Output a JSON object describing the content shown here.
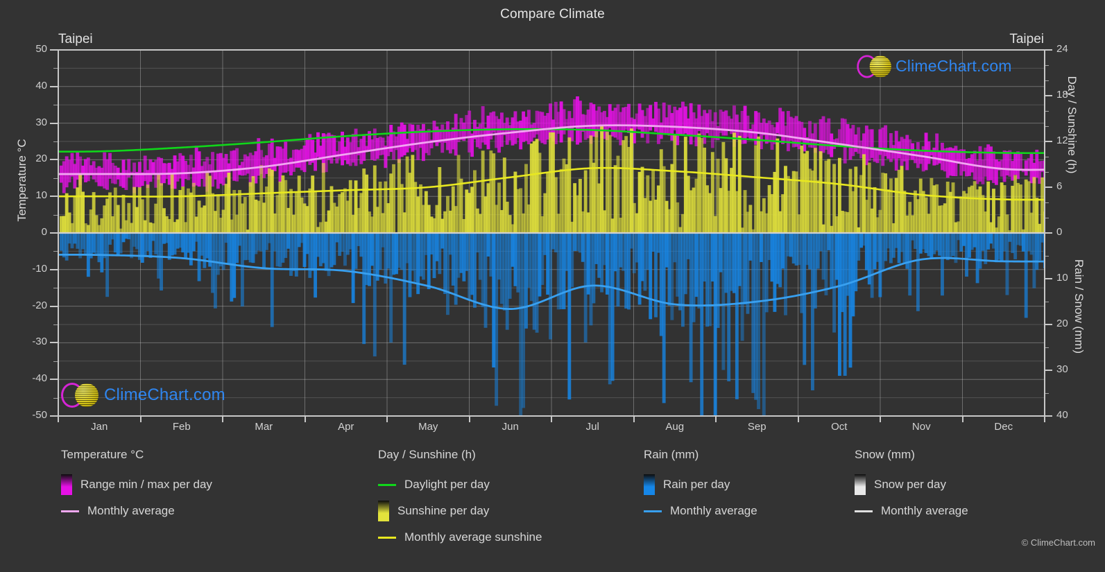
{
  "header": {
    "title": "Compare Climate",
    "city_left": "Taipei",
    "city_right": "Taipei"
  },
  "axes": {
    "left_title": "Temperature °C",
    "left_ticks": [
      "50",
      "40",
      "30",
      "20",
      "10",
      "0",
      "-10",
      "-20",
      "-30",
      "-40",
      "-50"
    ],
    "right_top_title": "Day / Sunshine (h)",
    "right_top_ticks": [
      "24",
      "18",
      "12",
      "6",
      "0"
    ],
    "right_bottom_title": "Rain / Snow (mm)",
    "right_bottom_ticks": [
      "10",
      "20",
      "30",
      "40"
    ],
    "x_ticks": [
      "Jan",
      "Feb",
      "Mar",
      "Apr",
      "May",
      "Jun",
      "Jul",
      "Aug",
      "Sep",
      "Oct",
      "Nov",
      "Dec"
    ]
  },
  "logo": {
    "text": "ClimeChart.com",
    "arc_color": "#d524d5",
    "ball_color": "#d6c419",
    "text_color": "#2f86f0"
  },
  "legend": {
    "columns": [
      {
        "heading": "Temperature °C",
        "items": [
          {
            "label": "Range min / max per day",
            "mark": "swatch",
            "color": "#e611e6"
          },
          {
            "label": "Monthly average",
            "mark": "line",
            "color": "#f0a8f0"
          }
        ]
      },
      {
        "heading": "Day / Sunshine (h)",
        "items": [
          {
            "label": "Daylight per day",
            "mark": "line",
            "color": "#10d61a"
          },
          {
            "label": "Sunshine per day",
            "mark": "swatch",
            "color": "#e2e23c"
          },
          {
            "label": "Monthly average sunshine",
            "mark": "line",
            "color": "#e8e820"
          }
        ]
      },
      {
        "heading": "Rain (mm)",
        "items": [
          {
            "label": "Rain per day",
            "mark": "swatch",
            "color": "#1687e8"
          },
          {
            "label": "Monthly average",
            "mark": "line",
            "color": "#38a0f0"
          }
        ]
      },
      {
        "heading": "Snow (mm)",
        "items": [
          {
            "label": "Snow per day",
            "mark": "swatch",
            "color": "#e8e8e8"
          },
          {
            "label": "Monthly average",
            "mark": "line",
            "color": "#e0e0e0"
          }
        ]
      }
    ]
  },
  "copyright": "© ClimeChart.com",
  "chart_data": {
    "type": "line",
    "title": "Compare Climate",
    "subtitle": "Taipei",
    "xlabel": "",
    "ylabel": "Temperature °C",
    "y2label_top": "Day / Sunshine (h)",
    "y2label_bottom": "Rain / Snow (mm)",
    "ylim": [
      -50,
      50
    ],
    "y2lim_top": [
      0,
      24
    ],
    "y2lim_bottom": [
      0,
      40
    ],
    "grid": true,
    "legend_position": "below",
    "categories": [
      "Jan",
      "Feb",
      "Mar",
      "Apr",
      "May",
      "Jun",
      "Jul",
      "Aug",
      "Sep",
      "Oct",
      "Nov",
      "Dec"
    ],
    "series": [
      {
        "name": "Monthly average temperature (°C)",
        "color": "#f0a8f0",
        "values": [
          16.1,
          16.3,
          18.1,
          21.5,
          24.8,
          27.4,
          29.3,
          29.0,
          27.4,
          24.3,
          21.0,
          17.5
        ]
      },
      {
        "name": "Daily max temperature range top (°C)",
        "color": "#e611e6",
        "values": [
          19.5,
          20.0,
          22.5,
          26.0,
          29.0,
          32.0,
          34.0,
          33.5,
          31.5,
          28.0,
          24.5,
          21.0
        ]
      },
      {
        "name": "Daily min temperature range bottom (°C)",
        "color": "#e611e6",
        "values": [
          13.5,
          13.8,
          15.5,
          19.0,
          22.5,
          25.0,
          26.5,
          26.3,
          25.0,
          22.0,
          18.5,
          15.0
        ]
      },
      {
        "name": "Daylight per day (h)",
        "color": "#10d61a",
        "values": [
          10.7,
          11.2,
          11.9,
          12.7,
          13.3,
          13.6,
          13.5,
          12.9,
          12.2,
          11.4,
          10.8,
          10.5
        ]
      },
      {
        "name": "Monthly average sunshine (h)",
        "color": "#e8e820",
        "values": [
          4.8,
          4.8,
          5.2,
          5.6,
          6.0,
          7.3,
          8.5,
          8.1,
          7.3,
          6.4,
          5.0,
          4.4
        ]
      },
      {
        "name": "Monthly average rain (mm)",
        "color": "#38a0f0",
        "values": [
          4.8,
          5.5,
          7.7,
          8.3,
          11.6,
          16.6,
          11.5,
          15.6,
          15.0,
          11.6,
          5.8,
          6.2
        ]
      }
    ]
  }
}
